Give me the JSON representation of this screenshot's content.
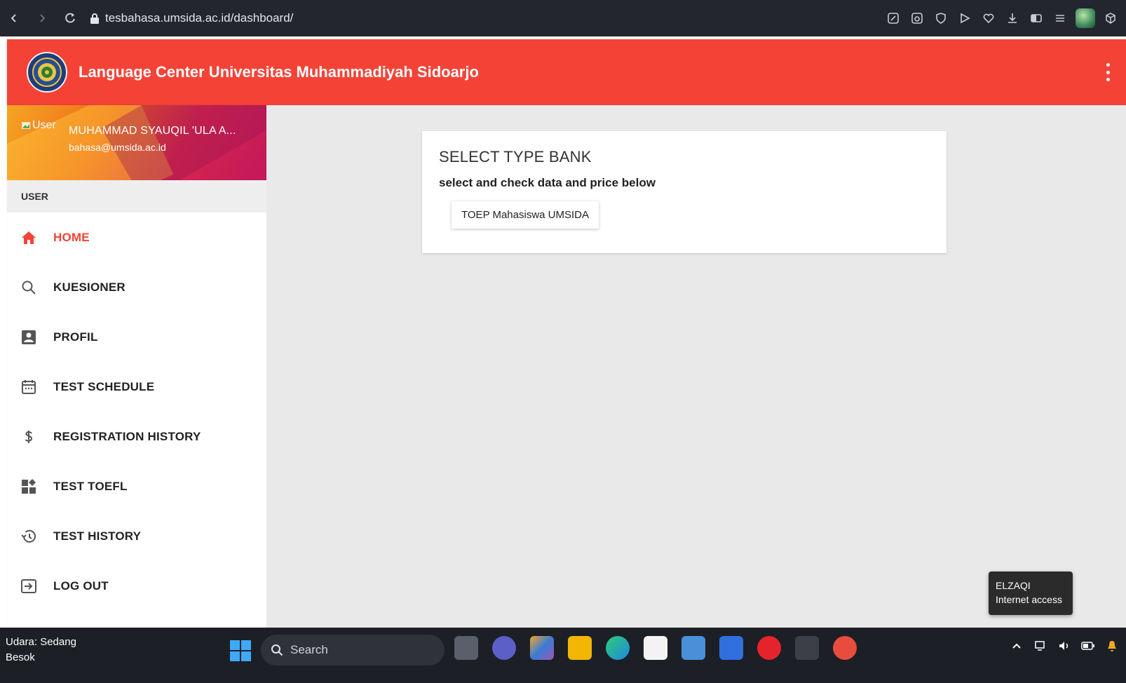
{
  "browser": {
    "url": "tesbahasa.umsida.ac.id/dashboard/"
  },
  "app": {
    "title": "Language Center Universitas Muhammadiyah Sidoarjo"
  },
  "user": {
    "image_alt": "User",
    "name": "MUHAMMAD SYAUQIL 'ULA A...",
    "email": "bahasa@umsida.ac.id"
  },
  "sidebar": {
    "section": "USER",
    "items": [
      {
        "label": "HOME",
        "icon": "home-icon"
      },
      {
        "label": "KUESIONER",
        "icon": "search-icon"
      },
      {
        "label": "PROFIL",
        "icon": "account-box-icon"
      },
      {
        "label": "TEST SCHEDULE",
        "icon": "calendar-icon"
      },
      {
        "label": "REGISTRATION HISTORY",
        "icon": "dollar-icon"
      },
      {
        "label": "TEST TOEFL",
        "icon": "dashboard-icon"
      },
      {
        "label": "TEST HISTORY",
        "icon": "history-icon"
      },
      {
        "label": "LOG OUT",
        "icon": "logout-icon"
      }
    ],
    "active_color": "#f44336"
  },
  "main": {
    "card_title": "SELECT TYPE BANK",
    "card_subtitle": "select and check data and price below",
    "type_button": "TOEP Mahasiswa UMSIDA"
  },
  "tooltip": {
    "line1": "ELZAQI",
    "line2": "Internet access"
  },
  "taskbar": {
    "weather_line1": "Udara: Sedang",
    "weather_line2": "Besok",
    "search_label": "Search"
  },
  "colors": {
    "header": "#f44336",
    "browser_bar": "#23262e",
    "taskbar": "#1c1f26"
  }
}
